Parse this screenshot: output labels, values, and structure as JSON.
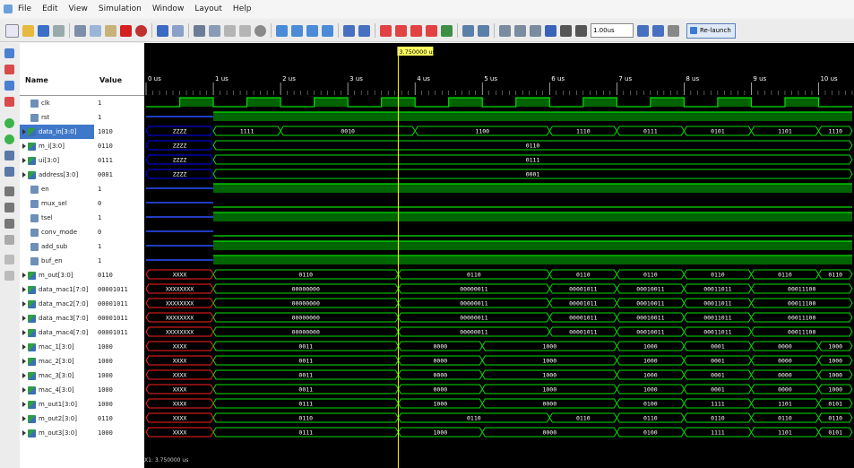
{
  "menu": [
    "File",
    "Edit",
    "View",
    "Simulation",
    "Window",
    "Layout",
    "Help"
  ],
  "toolbar": {
    "time_value": "1.00us",
    "relaunch_label": "Re-launch"
  },
  "columns": {
    "name": "Name",
    "value": "Value"
  },
  "cursor": {
    "label": "3.750000 us",
    "time": 3.75
  },
  "status": {
    "text": "X1: 3.750000 us"
  },
  "time_axis": {
    "start": 0,
    "end": 10.5,
    "ticks": [
      "0 us",
      "1 us",
      "2 us",
      "3 us",
      "4 us",
      "5 us",
      "6 us",
      "7 us",
      "8 us",
      "9 us",
      "10 us"
    ]
  },
  "signals": [
    {
      "name": "clk",
      "value": "1",
      "kind": "bit",
      "pattern": "clock",
      "period": 1.0
    },
    {
      "name": "rst",
      "value": "1",
      "kind": "bit",
      "pattern": "high_from",
      "start": 1.0
    },
    {
      "name": "data_in[3:0]",
      "value": "1010",
      "kind": "bus",
      "selected": true,
      "segments": [
        {
          "s": 0,
          "e": 1,
          "v": "ZZZZ",
          "c": "#0000ff"
        },
        {
          "s": 1,
          "e": 2,
          "v": "1111"
        },
        {
          "s": 2,
          "e": 4,
          "v": "0010"
        },
        {
          "s": 4,
          "e": 6,
          "v": "1100"
        },
        {
          "s": 6,
          "e": 7,
          "v": "1110"
        },
        {
          "s": 7,
          "e": 8,
          "v": "0111"
        },
        {
          "s": 8,
          "e": 9,
          "v": "0101"
        },
        {
          "s": 9,
          "e": 10,
          "v": "1101"
        },
        {
          "s": 10,
          "e": 10.5,
          "v": "1110"
        }
      ]
    },
    {
      "name": "m_i[3:0]",
      "value": "0110",
      "kind": "bus",
      "segments": [
        {
          "s": 0,
          "e": 1,
          "v": "ZZZZ",
          "c": "#0000ff"
        },
        {
          "s": 1,
          "e": 10.5,
          "v": "0110"
        }
      ]
    },
    {
      "name": "ui[3:0]",
      "value": "0111",
      "kind": "bus",
      "segments": [
        {
          "s": 0,
          "e": 1,
          "v": "ZZZZ",
          "c": "#0000ff"
        },
        {
          "s": 1,
          "e": 10.5,
          "v": "0111"
        }
      ]
    },
    {
      "name": "address[3:0]",
      "value": "0001",
      "kind": "bus",
      "segments": [
        {
          "s": 0,
          "e": 1,
          "v": "ZZZZ",
          "c": "#0000ff"
        },
        {
          "s": 1,
          "e": 10.5,
          "v": "0001"
        }
      ]
    },
    {
      "name": "en",
      "value": "1",
      "kind": "bit",
      "pattern": "high_from",
      "start": 1.0
    },
    {
      "name": "mux_sel",
      "value": "0",
      "kind": "bit",
      "pattern": "low_from",
      "start": 1.0
    },
    {
      "name": "tsel",
      "value": "1",
      "kind": "bit",
      "pattern": "high_from",
      "start": 1.0
    },
    {
      "name": "conv_mode",
      "value": "0",
      "kind": "bit",
      "pattern": "low_from",
      "start": 1.0
    },
    {
      "name": "add_sub",
      "value": "1",
      "kind": "bit",
      "pattern": "high_from",
      "start": 1.0
    },
    {
      "name": "buf_en",
      "value": "1",
      "kind": "bit",
      "pattern": "high_from",
      "start": 1.0
    },
    {
      "name": "m_out[3:0]",
      "value": "0110",
      "kind": "bus",
      "segments": [
        {
          "s": 0,
          "e": 1,
          "v": "XXXX",
          "c": "#ff2020"
        },
        {
          "s": 1,
          "e": 3.75,
          "v": "0110"
        },
        {
          "s": 3.75,
          "e": 6,
          "v": "0110"
        },
        {
          "s": 6,
          "e": 7,
          "v": "0110"
        },
        {
          "s": 7,
          "e": 8,
          "v": "0110"
        },
        {
          "s": 8,
          "e": 9,
          "v": "0110"
        },
        {
          "s": 9,
          "e": 10,
          "v": "0110"
        },
        {
          "s": 10,
          "e": 10.5,
          "v": "0110"
        }
      ]
    },
    {
      "name": "data_mac1[7:0]",
      "value": "00001011",
      "kind": "bus",
      "segments": [
        {
          "s": 0,
          "e": 1,
          "v": "XXXXXXXX",
          "c": "#ff2020"
        },
        {
          "s": 1,
          "e": 3.75,
          "v": "00000000"
        },
        {
          "s": 3.75,
          "e": 6,
          "v": "00000011"
        },
        {
          "s": 6,
          "e": 7,
          "v": "00001011"
        },
        {
          "s": 7,
          "e": 8,
          "v": "00010011"
        },
        {
          "s": 8,
          "e": 9,
          "v": "00011011"
        },
        {
          "s": 9,
          "e": 10.5,
          "v": "00011100"
        }
      ]
    },
    {
      "name": "data_mac2[7:0]",
      "value": "00001011",
      "kind": "bus",
      "segments": [
        {
          "s": 0,
          "e": 1,
          "v": "XXXXXXXX",
          "c": "#ff2020"
        },
        {
          "s": 1,
          "e": 3.75,
          "v": "00000000"
        },
        {
          "s": 3.75,
          "e": 6,
          "v": "00000011"
        },
        {
          "s": 6,
          "e": 7,
          "v": "00001011"
        },
        {
          "s": 7,
          "e": 8,
          "v": "00010011"
        },
        {
          "s": 8,
          "e": 9,
          "v": "00011011"
        },
        {
          "s": 9,
          "e": 10.5,
          "v": "00011100"
        }
      ]
    },
    {
      "name": "data_mac3[7:0]",
      "value": "00001011",
      "kind": "bus",
      "segments": [
        {
          "s": 0,
          "e": 1,
          "v": "XXXXXXXX",
          "c": "#ff2020"
        },
        {
          "s": 1,
          "e": 3.75,
          "v": "00000000"
        },
        {
          "s": 3.75,
          "e": 6,
          "v": "00000011"
        },
        {
          "s": 6,
          "e": 7,
          "v": "00001011"
        },
        {
          "s": 7,
          "e": 8,
          "v": "00010011"
        },
        {
          "s": 8,
          "e": 9,
          "v": "00011011"
        },
        {
          "s": 9,
          "e": 10.5,
          "v": "00011100"
        }
      ]
    },
    {
      "name": "data_mac4[7:0]",
      "value": "00001011",
      "kind": "bus",
      "segments": [
        {
          "s": 0,
          "e": 1,
          "v": "XXXXXXXX",
          "c": "#ff2020"
        },
        {
          "s": 1,
          "e": 3.75,
          "v": "00000000"
        },
        {
          "s": 3.75,
          "e": 6,
          "v": "00000011"
        },
        {
          "s": 6,
          "e": 7,
          "v": "00001011"
        },
        {
          "s": 7,
          "e": 8,
          "v": "00010011"
        },
        {
          "s": 8,
          "e": 9,
          "v": "00011011"
        },
        {
          "s": 9,
          "e": 10.5,
          "v": "00011100"
        }
      ]
    },
    {
      "name": "mac_1[3:0]",
      "value": "1000",
      "kind": "bus",
      "segments": [
        {
          "s": 0,
          "e": 1,
          "v": "XXXX",
          "c": "#ff2020"
        },
        {
          "s": 1,
          "e": 3.75,
          "v": "0011"
        },
        {
          "s": 3.75,
          "e": 5,
          "v": "0000"
        },
        {
          "s": 5,
          "e": 7,
          "v": "1000"
        },
        {
          "s": 7,
          "e": 8,
          "v": "1000"
        },
        {
          "s": 8,
          "e": 9,
          "v": "0001"
        },
        {
          "s": 9,
          "e": 10,
          "v": "0000"
        },
        {
          "s": 10,
          "e": 10.5,
          "v": "1000"
        }
      ]
    },
    {
      "name": "mac_2[3:0]",
      "value": "1000",
      "kind": "bus",
      "segments": [
        {
          "s": 0,
          "e": 1,
          "v": "XXXX",
          "c": "#ff2020"
        },
        {
          "s": 1,
          "e": 3.75,
          "v": "0011"
        },
        {
          "s": 3.75,
          "e": 5,
          "v": "0000"
        },
        {
          "s": 5,
          "e": 7,
          "v": "1000"
        },
        {
          "s": 7,
          "e": 8,
          "v": "1000"
        },
        {
          "s": 8,
          "e": 9,
          "v": "0001"
        },
        {
          "s": 9,
          "e": 10,
          "v": "0000"
        },
        {
          "s": 10,
          "e": 10.5,
          "v": "1000"
        }
      ]
    },
    {
      "name": "mac_3[3:0]",
      "value": "1000",
      "kind": "bus",
      "segments": [
        {
          "s": 0,
          "e": 1,
          "v": "XXXX",
          "c": "#ff2020"
        },
        {
          "s": 1,
          "e": 3.75,
          "v": "0011"
        },
        {
          "s": 3.75,
          "e": 5,
          "v": "0000"
        },
        {
          "s": 5,
          "e": 7,
          "v": "1000"
        },
        {
          "s": 7,
          "e": 8,
          "v": "1000"
        },
        {
          "s": 8,
          "e": 9,
          "v": "0001"
        },
        {
          "s": 9,
          "e": 10,
          "v": "0000"
        },
        {
          "s": 10,
          "e": 10.5,
          "v": "1000"
        }
      ]
    },
    {
      "name": "mac_4[3:0]",
      "value": "1000",
      "kind": "bus",
      "segments": [
        {
          "s": 0,
          "e": 1,
          "v": "XXXX",
          "c": "#ff2020"
        },
        {
          "s": 1,
          "e": 3.75,
          "v": "0011"
        },
        {
          "s": 3.75,
          "e": 5,
          "v": "0000"
        },
        {
          "s": 5,
          "e": 7,
          "v": "1000"
        },
        {
          "s": 7,
          "e": 8,
          "v": "1000"
        },
        {
          "s": 8,
          "e": 9,
          "v": "0001"
        },
        {
          "s": 9,
          "e": 10,
          "v": "0000"
        },
        {
          "s": 10,
          "e": 10.5,
          "v": "1000"
        }
      ]
    },
    {
      "name": "m_out1[3:0]",
      "value": "1000",
      "kind": "bus",
      "segments": [
        {
          "s": 0,
          "e": 1,
          "v": "XXXX",
          "c": "#ff2020"
        },
        {
          "s": 1,
          "e": 3.75,
          "v": "0111"
        },
        {
          "s": 3.75,
          "e": 5,
          "v": "1000"
        },
        {
          "s": 5,
          "e": 7,
          "v": "0000"
        },
        {
          "s": 7,
          "e": 8,
          "v": "0100"
        },
        {
          "s": 8,
          "e": 9,
          "v": "1111"
        },
        {
          "s": 9,
          "e": 10,
          "v": "1101"
        },
        {
          "s": 10,
          "e": 10.5,
          "v": "0101"
        }
      ]
    },
    {
      "name": "m_out2[3:0]",
      "value": "0110",
      "kind": "bus",
      "segments": [
        {
          "s": 0,
          "e": 1,
          "v": "XXXX",
          "c": "#ff2020"
        },
        {
          "s": 1,
          "e": 3.75,
          "v": "0110"
        },
        {
          "s": 3.75,
          "e": 6,
          "v": "0110"
        },
        {
          "s": 6,
          "e": 7,
          "v": "0110"
        },
        {
          "s": 7,
          "e": 8,
          "v": "0110"
        },
        {
          "s": 8,
          "e": 9,
          "v": "0110"
        },
        {
          "s": 9,
          "e": 10,
          "v": "0110"
        },
        {
          "s": 10,
          "e": 10.5,
          "v": "0110"
        }
      ]
    },
    {
      "name": "m_out3[3:0]",
      "value": "1000",
      "kind": "bus",
      "segments": [
        {
          "s": 0,
          "e": 1,
          "v": "XXXX",
          "c": "#ff2020"
        },
        {
          "s": 1,
          "e": 3.75,
          "v": "0111"
        },
        {
          "s": 3.75,
          "e": 5,
          "v": "1000"
        },
        {
          "s": 5,
          "e": 7,
          "v": "0000"
        },
        {
          "s": 7,
          "e": 8,
          "v": "0100"
        },
        {
          "s": 8,
          "e": 9,
          "v": "1111"
        },
        {
          "s": 9,
          "e": 10,
          "v": "1101"
        },
        {
          "s": 10,
          "e": 10.5,
          "v": "0101"
        }
      ]
    }
  ],
  "colors": {
    "wave": "#00e000",
    "wave_fill": "#006400",
    "cursor": "#ffff00",
    "background": "#000000",
    "selected_row": "#3f78c9"
  }
}
